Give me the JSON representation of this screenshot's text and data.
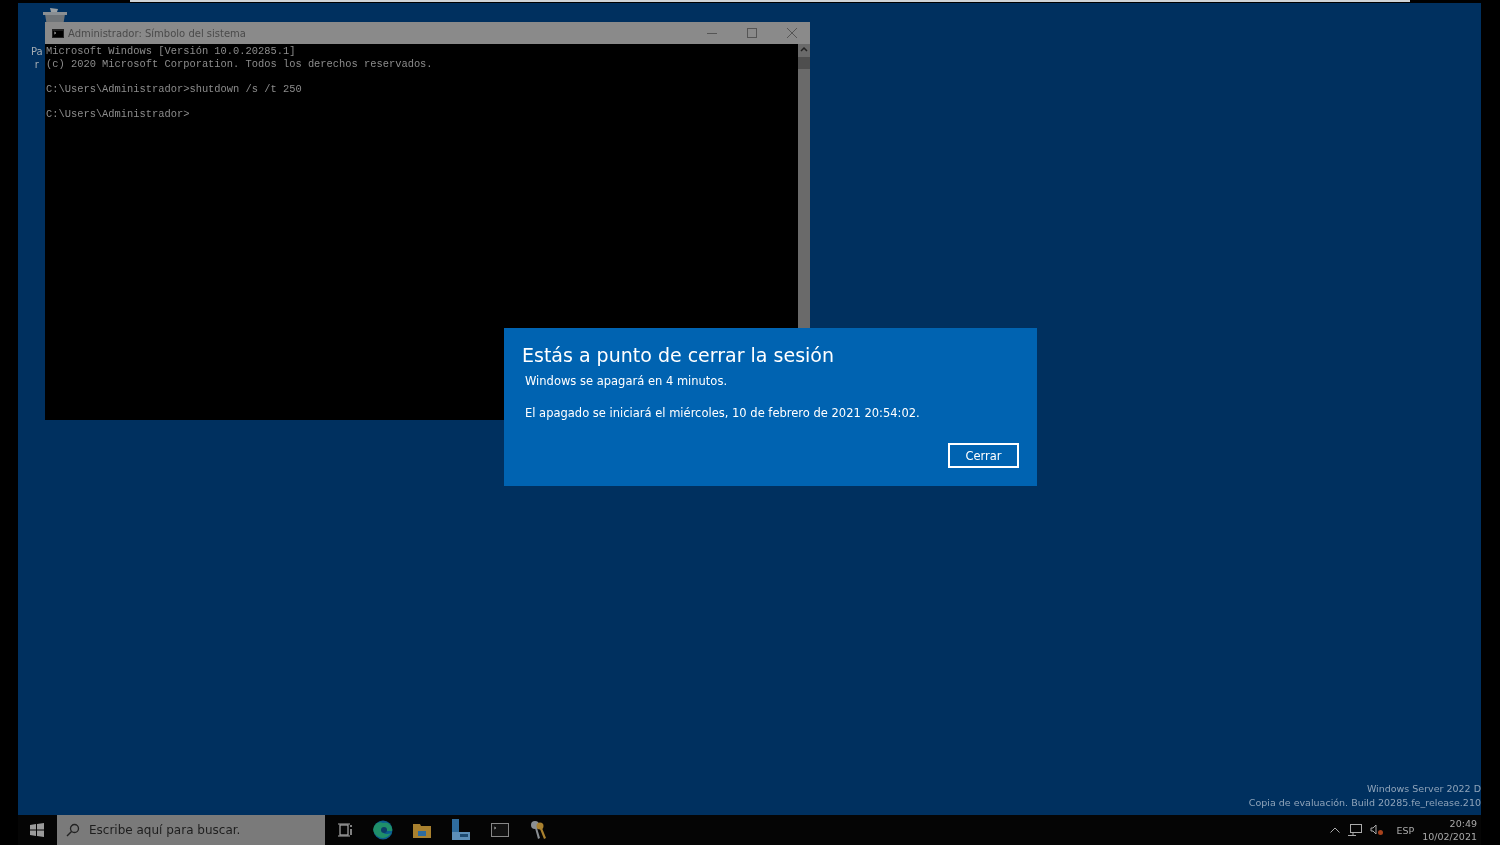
{
  "desktop": {
    "icon_label_lines": [
      "Pa",
      "r"
    ]
  },
  "console_window": {
    "title": "Administrador: Símbolo del sistema",
    "blocks": [
      [
        "Microsoft Windows [Versión 10.0.20285.1]",
        "(c) 2020 Microsoft Corporation. Todos los derechos reservados."
      ],
      [
        "C:\\Users\\Administrador>shutdown /s /t 250"
      ],
      [
        "C:\\Users\\Administrador>"
      ]
    ]
  },
  "dialog": {
    "title": "Estás a punto de cerrar la sesión",
    "message": "Windows se apagará en 4 minutos.",
    "detail": "El apagado se iniciará el miércoles, 10 de febrero de 2021 20:54:02.",
    "button": "Cerrar"
  },
  "desktop_notice": [
    "Windows Server 2022 D",
    "Copia de evaluación. Build 20285.fe_release.210"
  ],
  "taskbar": {
    "search_placeholder": "Escribe aquí para buscar.",
    "apps": [
      {
        "kind": "task-view"
      },
      {
        "kind": "browser"
      },
      {
        "kind": "folder"
      },
      {
        "kind": "server-manager"
      },
      {
        "kind": "terminal"
      },
      {
        "kind": "keys"
      }
    ],
    "tray": {
      "language": "ESP",
      "time": "20:49",
      "date": "10/02/2021"
    }
  }
}
